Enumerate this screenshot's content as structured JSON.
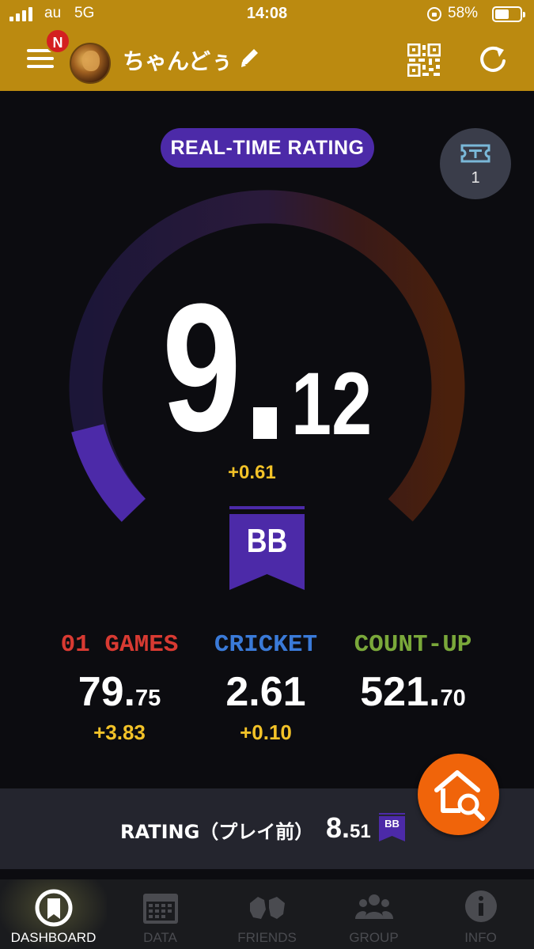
{
  "status_bar": {
    "carrier": "au",
    "network": "5G",
    "time": "14:08",
    "battery_percent": "58%",
    "battery_level": 0.58
  },
  "header": {
    "notification_badge": "N",
    "username": "ちゃんどぅ",
    "icons": [
      "menu-icon",
      "pencil-icon",
      "qr-code-icon",
      "refresh-icon"
    ],
    "background_color": "#bb8a10"
  },
  "main": {
    "realtime_label": "REAL-TIME RATING",
    "ticket_count": "1",
    "rating_integer": "9",
    "rating_decimal": "12",
    "rating_delta": "+0.61",
    "class_badge": "BB",
    "accent_color": "#4c2aa8"
  },
  "stats": [
    {
      "label": "01 GAMES",
      "value_int": "79.",
      "value_dec": "75",
      "delta": "+3.83",
      "color": "#d83a32"
    },
    {
      "label": "CRICKET",
      "value_int": "2.61",
      "value_dec": "",
      "delta": "+0.10",
      "color": "#3a7ad8"
    },
    {
      "label": "COUNT-UP",
      "value_int": "521.",
      "value_dec": "70",
      "delta": "",
      "color": "#7aa83a"
    }
  ],
  "pre_play": {
    "label": "RATING（プレイ前）",
    "value_int": "8.",
    "value_dec": "51",
    "badge": "BB"
  },
  "tabs": [
    {
      "label": "DASHBOARD",
      "icon": "dashboard-icon",
      "active": true
    },
    {
      "label": "DATA",
      "icon": "calendar-icon",
      "active": false
    },
    {
      "label": "FRIENDS",
      "icon": "friends-icon",
      "active": false
    },
    {
      "label": "GROUP",
      "icon": "group-icon",
      "active": false
    },
    {
      "label": "INFO",
      "icon": "info-icon",
      "active": false
    }
  ]
}
